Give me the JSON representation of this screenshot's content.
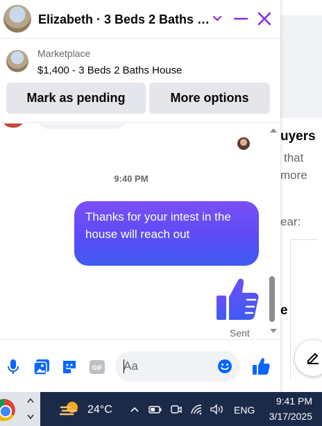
{
  "header": {
    "title": "Elizabeth · 3 Beds 2 Baths …",
    "accent_color": "#8a2be2"
  },
  "listing": {
    "source": "Marketplace",
    "title": "$1,400 - 3 Beds 2 Baths House",
    "buttons": [
      "Mark as pending",
      "More options"
    ]
  },
  "messages": {
    "timestamp": "9:40 PM",
    "outgoing_text": "Thanks  for  your intest  in the  house will  reach out",
    "status": "Sent",
    "bubble_gradient": [
      "#7a4ff7",
      "#3f5bf2"
    ]
  },
  "composer": {
    "placeholder": "Aa",
    "icons": [
      "microphone-icon",
      "photo-icon",
      "sticker-icon",
      "gif-icon",
      "emoji-icon",
      "thumbs-up-icon"
    ]
  },
  "background_page": {
    "heading_fragment": "uyers",
    "text_lines": [
      "that",
      "more"
    ],
    "label_fragment": "ear:",
    "side_fragment": "e"
  },
  "taskbar": {
    "temperature": "24°C",
    "language": "ENG",
    "time": "9:41 PM",
    "date": "3/17/2025"
  }
}
